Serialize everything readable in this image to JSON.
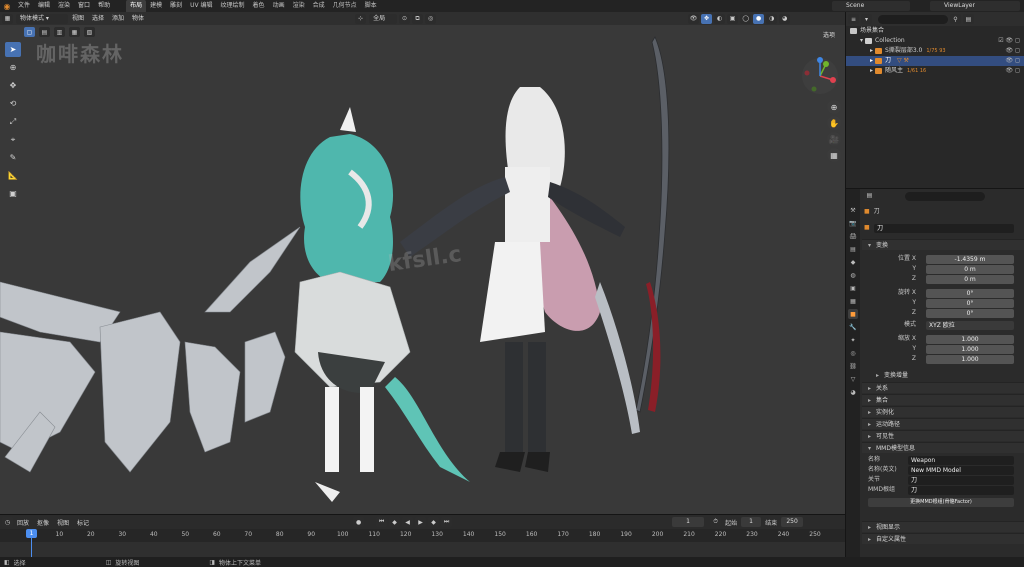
{
  "topbar": {
    "menus": [
      "文件",
      "编辑",
      "渲染",
      "窗口",
      "帮助"
    ],
    "workspaces": [
      "布局",
      "建模",
      "雕刻",
      "UV 编辑",
      "纹理绘制",
      "着色",
      "动画",
      "渲染",
      "合成",
      "几何节点",
      "脚本"
    ],
    "active_workspace": "布局",
    "scene": "Scene",
    "view_layer": "ViewLayer"
  },
  "viewport": {
    "mode": "物体模式",
    "menus": [
      "视图",
      "选择",
      "添加",
      "物体"
    ],
    "transform_orientation": "全局",
    "options_label": "选项",
    "watermark_text": "咖啡森林",
    "watermark_url": "kfsll.c"
  },
  "outliner": {
    "search_placeholder": "",
    "rows": [
      {
        "label": "场景集合",
        "indent": 0
      },
      {
        "label": "Collection",
        "indent": 1
      },
      {
        "label": "S撕裂层部3.0",
        "indent": 2,
        "extra": "1/75 93"
      },
      {
        "label": "刀",
        "indent": 2,
        "selected": true
      },
      {
        "label": "随风主",
        "indent": 2,
        "extra": "1/61 16"
      }
    ]
  },
  "properties": {
    "object_name": "刀",
    "object_field": "刀",
    "transform_title": "变换",
    "location_label": "位置 X",
    "location": [
      "-1.4359 m",
      "0 m",
      "0 m"
    ],
    "rotation_label": "旋转 X",
    "rotation": [
      "0°",
      "0°",
      "0°"
    ],
    "mode_label": "模式",
    "mode_value": "XYZ 欧拉",
    "scale_label": "缩放 X",
    "scale": [
      "1.000",
      "1.000",
      "1.000"
    ],
    "axis_y": "Y",
    "axis_z": "Z",
    "delta_transform": "变换增量",
    "panels": [
      "关系",
      "集合",
      "实例化",
      "运动路径",
      "可见性"
    ],
    "mmd_title": "MMD模型信息",
    "mmd_name_label": "名称",
    "mmd_name": "Weapon",
    "mmd_name_en_label": "名称(英文)",
    "mmd_name_en": "New MMD Model",
    "mmd_joint_label": "关节",
    "mmd_joint": "刀",
    "mmd_material_label": "MMD根组",
    "mmd_material": "刀",
    "mmd_button": "更换MMD根组(骨骼Factor)",
    "bottom_panels": [
      "视图显示",
      "自定义属性"
    ]
  },
  "timeline": {
    "menus": [
      "回放",
      "抠像",
      "视图",
      "标记"
    ],
    "current_frame": "1",
    "start_label": "起始",
    "start": "1",
    "end_label": "结束",
    "end": "250",
    "ticks": [
      "1",
      "10",
      "20",
      "30",
      "40",
      "50",
      "60",
      "70",
      "80",
      "90",
      "100",
      "110",
      "120",
      "130",
      "140",
      "150",
      "160",
      "170",
      "180",
      "190",
      "200",
      "210",
      "220",
      "230",
      "240",
      "250"
    ]
  },
  "statusbar": {
    "items": [
      "选择",
      "旋转视图",
      "物体上下文菜单"
    ]
  },
  "colors": {
    "accent": "#4772b3",
    "selected_row": "#334d80",
    "orange": "#e08a2e",
    "viewport_bg": "#393939"
  }
}
